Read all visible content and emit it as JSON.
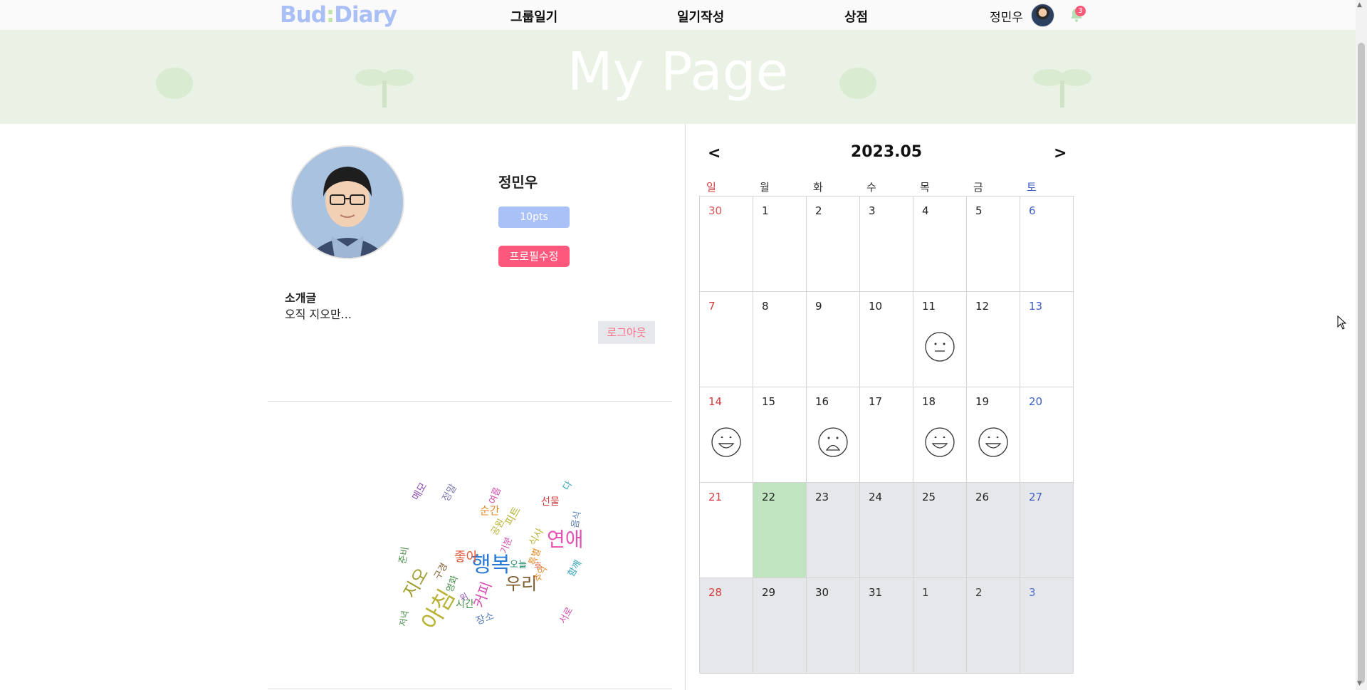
{
  "header": {
    "logo_part1": "Bud",
    "logo_colon": ":",
    "logo_part2": "Diary",
    "nav": [
      "그룹일기",
      "일기작성",
      "상점"
    ],
    "user_name": "정민우",
    "notification_count": "3"
  },
  "banner": {
    "title": "My Page"
  },
  "profile": {
    "name": "정민우",
    "points": "10pts",
    "edit_label": "프로필수정",
    "intro_title": "소개글",
    "intro_text": "오직 지오만...",
    "logout_label": "로그아웃"
  },
  "wordcloud": {
    "words": [
      "행복",
      "아침",
      "지오",
      "연애",
      "우리",
      "좋아",
      "커피",
      "시간",
      "장소",
      "선물",
      "순간",
      "메모",
      "정말",
      "추억",
      "오늘",
      "함께",
      "식사",
      "기분",
      "준비",
      "저녁",
      "서로",
      "후",
      "구경",
      "다",
      "피트",
      "여름",
      "공원",
      "특별",
      "영화",
      "음식",
      "위"
    ],
    "colors": [
      "#2b7bd6",
      "#b8b237",
      "#9d9b2a",
      "#e252b3",
      "#7a5a2a",
      "#e35a3a",
      "#d54fb0",
      "#4a8f4a",
      "#5a7fb0",
      "#d33c3c",
      "#e88a2a",
      "#8f4fb0",
      "#7a7ab0",
      "#e88a2a",
      "#2a8f6a",
      "#2a9fb8",
      "#b8b237",
      "#d54fb0",
      "#4a8f4a",
      "#4a8f4a",
      "#d54fb0",
      "#e35a3a",
      "#7a5a2a",
      "#2a9fb8",
      "#b8b237",
      "#d54fb0",
      "#b8b237",
      "#e88a2a",
      "#4a8f4a",
      "#5a7fb0",
      "#8f4fb0"
    ]
  },
  "calendar": {
    "title": "2023.05",
    "prev_label": "<",
    "next_label": ">",
    "weekdays": [
      "일",
      "월",
      "화",
      "수",
      "목",
      "금",
      "토"
    ],
    "weeks": [
      [
        {
          "d": "30",
          "state": "other"
        },
        {
          "d": "1"
        },
        {
          "d": "2"
        },
        {
          "d": "3"
        },
        {
          "d": "4"
        },
        {
          "d": "5"
        },
        {
          "d": "6"
        }
      ],
      [
        {
          "d": "7"
        },
        {
          "d": "8"
        },
        {
          "d": "9"
        },
        {
          "d": "10"
        },
        {
          "d": "11",
          "mood": "neutral"
        },
        {
          "d": "12"
        },
        {
          "d": "13"
        }
      ],
      [
        {
          "d": "14",
          "mood": "happy"
        },
        {
          "d": "15"
        },
        {
          "d": "16",
          "mood": "sad"
        },
        {
          "d": "17"
        },
        {
          "d": "18",
          "mood": "happy"
        },
        {
          "d": "19",
          "mood": "happy"
        },
        {
          "d": "20"
        }
      ],
      [
        {
          "d": "21"
        },
        {
          "d": "22",
          "state": "today"
        },
        {
          "d": "23",
          "state": "future"
        },
        {
          "d": "24",
          "state": "future"
        },
        {
          "d": "25",
          "state": "future"
        },
        {
          "d": "26",
          "state": "future"
        },
        {
          "d": "27",
          "state": "future"
        }
      ],
      [
        {
          "d": "28",
          "state": "future"
        },
        {
          "d": "29",
          "state": "future"
        },
        {
          "d": "30",
          "state": "future"
        },
        {
          "d": "31",
          "state": "future"
        },
        {
          "d": "1",
          "state": "future other"
        },
        {
          "d": "2",
          "state": "future other"
        },
        {
          "d": "3",
          "state": "future other"
        }
      ]
    ],
    "colors": {
      "sunday": "#d33c3c",
      "saturday": "#3c5ec4",
      "today": "#bfe4bf",
      "future": "#e5e7ea"
    }
  }
}
